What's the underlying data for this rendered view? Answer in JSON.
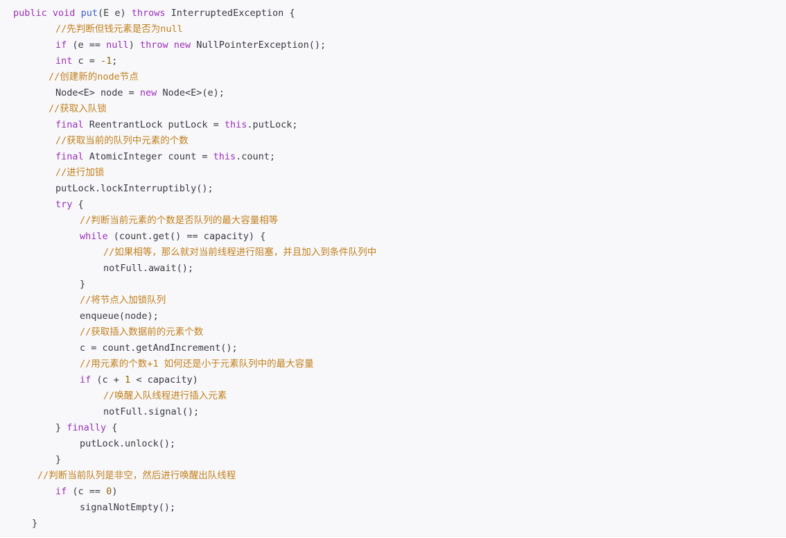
{
  "code": {
    "lines": [
      {
        "indent": 0,
        "tokens": [
          {
            "t": "public",
            "c": "kw"
          },
          {
            "t": " ",
            "c": "pl"
          },
          {
            "t": "void",
            "c": "kw"
          },
          {
            "t": " ",
            "c": "pl"
          },
          {
            "t": "put",
            "c": "fn"
          },
          {
            "t": "(E e) ",
            "c": "pl"
          },
          {
            "t": "throws",
            "c": "kw"
          },
          {
            "t": " InterruptedException {",
            "c": "pl"
          }
        ]
      },
      {
        "indent": 61,
        "tokens": [
          {
            "t": "//先判断但钱元素是否为null",
            "c": "cm"
          }
        ]
      },
      {
        "indent": 61,
        "tokens": [
          {
            "t": "if",
            "c": "kw"
          },
          {
            "t": " (e == ",
            "c": "pl"
          },
          {
            "t": "null",
            "c": "kw"
          },
          {
            "t": ") ",
            "c": "pl"
          },
          {
            "t": "throw",
            "c": "kw"
          },
          {
            "t": " ",
            "c": "pl"
          },
          {
            "t": "new",
            "c": "kw"
          },
          {
            "t": " NullPointerException();",
            "c": "pl"
          }
        ]
      },
      {
        "indent": 61,
        "tokens": [
          {
            "t": "int",
            "c": "kw"
          },
          {
            "t": " c = ",
            "c": "pl"
          },
          {
            "t": "-1",
            "c": "num"
          },
          {
            "t": ";",
            "c": "pl"
          }
        ]
      },
      {
        "indent": 51,
        "tokens": [
          {
            "t": "//创建新的node节点",
            "c": "cm"
          }
        ]
      },
      {
        "indent": 61,
        "tokens": [
          {
            "t": "Node<E> node = ",
            "c": "pl"
          },
          {
            "t": "new",
            "c": "kw"
          },
          {
            "t": " Node<E>(e);",
            "c": "pl"
          }
        ]
      },
      {
        "indent": 51,
        "tokens": [
          {
            "t": "//获取入队锁",
            "c": "cm"
          }
        ]
      },
      {
        "indent": 61,
        "tokens": [
          {
            "t": "final",
            "c": "kw"
          },
          {
            "t": " ReentrantLock putLock = ",
            "c": "pl"
          },
          {
            "t": "this",
            "c": "kw"
          },
          {
            "t": ".putLock;",
            "c": "pl"
          }
        ]
      },
      {
        "indent": 61,
        "tokens": [
          {
            "t": "//获取当前的队列中元素的个数",
            "c": "cm"
          }
        ]
      },
      {
        "indent": 61,
        "tokens": [
          {
            "t": "final",
            "c": "kw"
          },
          {
            "t": " AtomicInteger count = ",
            "c": "pl"
          },
          {
            "t": "this",
            "c": "kw"
          },
          {
            "t": ".count;",
            "c": "pl"
          }
        ]
      },
      {
        "indent": 61,
        "tokens": [
          {
            "t": "//进行加锁",
            "c": "cm"
          }
        ]
      },
      {
        "indent": 61,
        "tokens": [
          {
            "t": "putLock.lockInterruptibly();",
            "c": "pl"
          }
        ]
      },
      {
        "indent": 61,
        "tokens": [
          {
            "t": "try",
            "c": "kw"
          },
          {
            "t": " {",
            "c": "pl"
          }
        ]
      },
      {
        "indent": 96,
        "tokens": [
          {
            "t": "//判断当前元素的个数是否队列的最大容量相等",
            "c": "cm"
          }
        ]
      },
      {
        "indent": 96,
        "tokens": [
          {
            "t": "while",
            "c": "kw"
          },
          {
            "t": " (count.get() == capacity) {",
            "c": "pl"
          }
        ]
      },
      {
        "indent": 130,
        "tokens": [
          {
            "t": "//如果相等，那么就对当前线程进行阻塞，并且加入到条件队列中",
            "c": "cm"
          }
        ]
      },
      {
        "indent": 130,
        "tokens": [
          {
            "t": "notFull.await();",
            "c": "pl"
          }
        ]
      },
      {
        "indent": 96,
        "tokens": [
          {
            "t": "}",
            "c": "pl"
          }
        ]
      },
      {
        "indent": 96,
        "tokens": [
          {
            "t": "//将节点入加锁队列",
            "c": "cm"
          }
        ]
      },
      {
        "indent": 96,
        "tokens": [
          {
            "t": "enqueue(node);",
            "c": "pl"
          }
        ]
      },
      {
        "indent": 96,
        "tokens": [
          {
            "t": "//获取插入数据前的元素个数",
            "c": "cm"
          }
        ]
      },
      {
        "indent": 96,
        "tokens": [
          {
            "t": "c = count.getAndIncrement();",
            "c": "pl"
          }
        ]
      },
      {
        "indent": 96,
        "tokens": [
          {
            "t": "//用元素的个数+1 如何还是小于元素队列中的最大容量",
            "c": "cm"
          }
        ]
      },
      {
        "indent": 96,
        "tokens": [
          {
            "t": "if",
            "c": "kw"
          },
          {
            "t": " (c + ",
            "c": "pl"
          },
          {
            "t": "1",
            "c": "num"
          },
          {
            "t": " < capacity)",
            "c": "pl"
          }
        ]
      },
      {
        "indent": 130,
        "tokens": [
          {
            "t": "//唤醒入队线程进行插入元素",
            "c": "cm"
          }
        ]
      },
      {
        "indent": 130,
        "tokens": [
          {
            "t": "notFull.signal();",
            "c": "pl"
          }
        ]
      },
      {
        "indent": 61,
        "tokens": [
          {
            "t": "} ",
            "c": "pl"
          },
          {
            "t": "finally",
            "c": "kw"
          },
          {
            "t": " {",
            "c": "pl"
          }
        ]
      },
      {
        "indent": 96,
        "tokens": [
          {
            "t": "putLock.unlock();",
            "c": "pl"
          }
        ]
      },
      {
        "indent": 61,
        "tokens": [
          {
            "t": "}",
            "c": "pl"
          }
        ]
      },
      {
        "indent": 35,
        "tokens": [
          {
            "t": "//判断当前队列是非空，然后进行唤醒出队线程",
            "c": "cm"
          }
        ]
      },
      {
        "indent": 61,
        "tokens": [
          {
            "t": "if",
            "c": "kw"
          },
          {
            "t": " (c == ",
            "c": "pl"
          },
          {
            "t": "0",
            "c": "num"
          },
          {
            "t": ")",
            "c": "pl"
          }
        ]
      },
      {
        "indent": 96,
        "tokens": [
          {
            "t": "signalNotEmpty();",
            "c": "pl"
          }
        ]
      },
      {
        "indent": 27,
        "tokens": [
          {
            "t": "}",
            "c": "pl"
          }
        ]
      }
    ]
  }
}
